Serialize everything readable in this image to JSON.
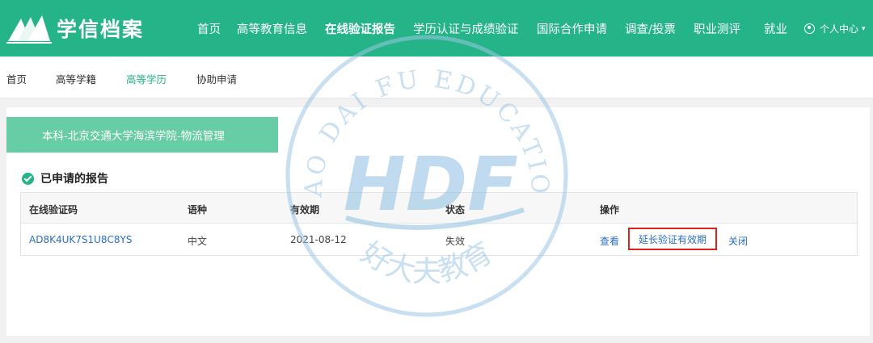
{
  "header": {
    "logo_text": "学信档案",
    "nav": [
      {
        "label": "首页",
        "active": false
      },
      {
        "label": "高等教育信息",
        "active": false
      },
      {
        "label": "在线验证报告",
        "active": true
      },
      {
        "label": "学历认证与成绩验证",
        "active": false
      },
      {
        "label": "国际合作申请",
        "active": false
      },
      {
        "label": "调查/投票",
        "active": false
      },
      {
        "label": "职业测评",
        "active": false
      },
      {
        "label": "就业",
        "active": false
      }
    ],
    "user_center": "个人中心"
  },
  "subnav": [
    {
      "label": "首页",
      "active": false
    },
    {
      "label": "高等学籍",
      "active": false
    },
    {
      "label": "高等学历",
      "active": true
    },
    {
      "label": "协助申请",
      "active": false
    }
  ],
  "degree": "本科-北京交通大学海滨学院-物流管理",
  "section_title": "已申请的报告",
  "table": {
    "headers": [
      "在线验证码",
      "语种",
      "有效期",
      "状态",
      "操作"
    ],
    "row": {
      "code": "AD8K4UK7S1U8C8YS",
      "language": "中文",
      "expiry": "2021-08-12",
      "status": "失效",
      "actions": {
        "view": "查看",
        "extend": "延长验证有效期",
        "close": "关闭"
      }
    }
  },
  "watermark": {
    "arc_text": "HAO DAI FU EDUCATION",
    "monogram": "HDF",
    "bottom_text": "好大夫教育"
  },
  "colors": {
    "brand": "#25b487",
    "subnav_active": "#25b487",
    "link": "#2a6fc4",
    "highlight_border": "#e02020"
  }
}
